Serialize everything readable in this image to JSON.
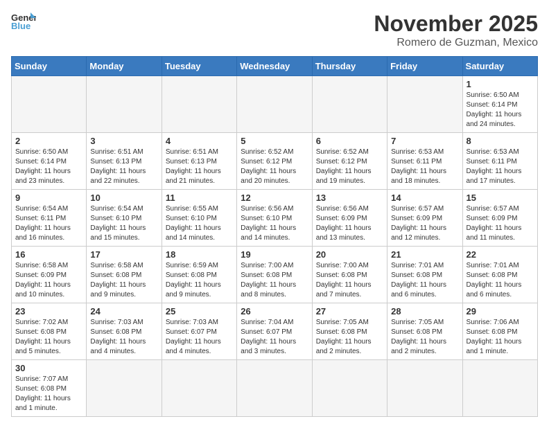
{
  "header": {
    "logo_general": "General",
    "logo_blue": "Blue",
    "month_title": "November 2025",
    "subtitle": "Romero de Guzman, Mexico"
  },
  "weekdays": [
    "Sunday",
    "Monday",
    "Tuesday",
    "Wednesday",
    "Thursday",
    "Friday",
    "Saturday"
  ],
  "weeks": [
    [
      {
        "day": "",
        "info": ""
      },
      {
        "day": "",
        "info": ""
      },
      {
        "day": "",
        "info": ""
      },
      {
        "day": "",
        "info": ""
      },
      {
        "day": "",
        "info": ""
      },
      {
        "day": "",
        "info": ""
      },
      {
        "day": "1",
        "info": "Sunrise: 6:50 AM\nSunset: 6:14 PM\nDaylight: 11 hours\nand 24 minutes."
      }
    ],
    [
      {
        "day": "2",
        "info": "Sunrise: 6:50 AM\nSunset: 6:14 PM\nDaylight: 11 hours\nand 23 minutes."
      },
      {
        "day": "3",
        "info": "Sunrise: 6:51 AM\nSunset: 6:13 PM\nDaylight: 11 hours\nand 22 minutes."
      },
      {
        "day": "4",
        "info": "Sunrise: 6:51 AM\nSunset: 6:13 PM\nDaylight: 11 hours\nand 21 minutes."
      },
      {
        "day": "5",
        "info": "Sunrise: 6:52 AM\nSunset: 6:12 PM\nDaylight: 11 hours\nand 20 minutes."
      },
      {
        "day": "6",
        "info": "Sunrise: 6:52 AM\nSunset: 6:12 PM\nDaylight: 11 hours\nand 19 minutes."
      },
      {
        "day": "7",
        "info": "Sunrise: 6:53 AM\nSunset: 6:11 PM\nDaylight: 11 hours\nand 18 minutes."
      },
      {
        "day": "8",
        "info": "Sunrise: 6:53 AM\nSunset: 6:11 PM\nDaylight: 11 hours\nand 17 minutes."
      }
    ],
    [
      {
        "day": "9",
        "info": "Sunrise: 6:54 AM\nSunset: 6:11 PM\nDaylight: 11 hours\nand 16 minutes."
      },
      {
        "day": "10",
        "info": "Sunrise: 6:54 AM\nSunset: 6:10 PM\nDaylight: 11 hours\nand 15 minutes."
      },
      {
        "day": "11",
        "info": "Sunrise: 6:55 AM\nSunset: 6:10 PM\nDaylight: 11 hours\nand 14 minutes."
      },
      {
        "day": "12",
        "info": "Sunrise: 6:56 AM\nSunset: 6:10 PM\nDaylight: 11 hours\nand 14 minutes."
      },
      {
        "day": "13",
        "info": "Sunrise: 6:56 AM\nSunset: 6:09 PM\nDaylight: 11 hours\nand 13 minutes."
      },
      {
        "day": "14",
        "info": "Sunrise: 6:57 AM\nSunset: 6:09 PM\nDaylight: 11 hours\nand 12 minutes."
      },
      {
        "day": "15",
        "info": "Sunrise: 6:57 AM\nSunset: 6:09 PM\nDaylight: 11 hours\nand 11 minutes."
      }
    ],
    [
      {
        "day": "16",
        "info": "Sunrise: 6:58 AM\nSunset: 6:09 PM\nDaylight: 11 hours\nand 10 minutes."
      },
      {
        "day": "17",
        "info": "Sunrise: 6:58 AM\nSunset: 6:08 PM\nDaylight: 11 hours\nand 9 minutes."
      },
      {
        "day": "18",
        "info": "Sunrise: 6:59 AM\nSunset: 6:08 PM\nDaylight: 11 hours\nand 9 minutes."
      },
      {
        "day": "19",
        "info": "Sunrise: 7:00 AM\nSunset: 6:08 PM\nDaylight: 11 hours\nand 8 minutes."
      },
      {
        "day": "20",
        "info": "Sunrise: 7:00 AM\nSunset: 6:08 PM\nDaylight: 11 hours\nand 7 minutes."
      },
      {
        "day": "21",
        "info": "Sunrise: 7:01 AM\nSunset: 6:08 PM\nDaylight: 11 hours\nand 6 minutes."
      },
      {
        "day": "22",
        "info": "Sunrise: 7:01 AM\nSunset: 6:08 PM\nDaylight: 11 hours\nand 6 minutes."
      }
    ],
    [
      {
        "day": "23",
        "info": "Sunrise: 7:02 AM\nSunset: 6:08 PM\nDaylight: 11 hours\nand 5 minutes."
      },
      {
        "day": "24",
        "info": "Sunrise: 7:03 AM\nSunset: 6:08 PM\nDaylight: 11 hours\nand 4 minutes."
      },
      {
        "day": "25",
        "info": "Sunrise: 7:03 AM\nSunset: 6:07 PM\nDaylight: 11 hours\nand 4 minutes."
      },
      {
        "day": "26",
        "info": "Sunrise: 7:04 AM\nSunset: 6:07 PM\nDaylight: 11 hours\nand 3 minutes."
      },
      {
        "day": "27",
        "info": "Sunrise: 7:05 AM\nSunset: 6:08 PM\nDaylight: 11 hours\nand 2 minutes."
      },
      {
        "day": "28",
        "info": "Sunrise: 7:05 AM\nSunset: 6:08 PM\nDaylight: 11 hours\nand 2 minutes."
      },
      {
        "day": "29",
        "info": "Sunrise: 7:06 AM\nSunset: 6:08 PM\nDaylight: 11 hours\nand 1 minute."
      }
    ],
    [
      {
        "day": "30",
        "info": "Sunrise: 7:07 AM\nSunset: 6:08 PM\nDaylight: 11 hours\nand 1 minute."
      },
      {
        "day": "",
        "info": ""
      },
      {
        "day": "",
        "info": ""
      },
      {
        "day": "",
        "info": ""
      },
      {
        "day": "",
        "info": ""
      },
      {
        "day": "",
        "info": ""
      },
      {
        "day": "",
        "info": ""
      }
    ]
  ]
}
